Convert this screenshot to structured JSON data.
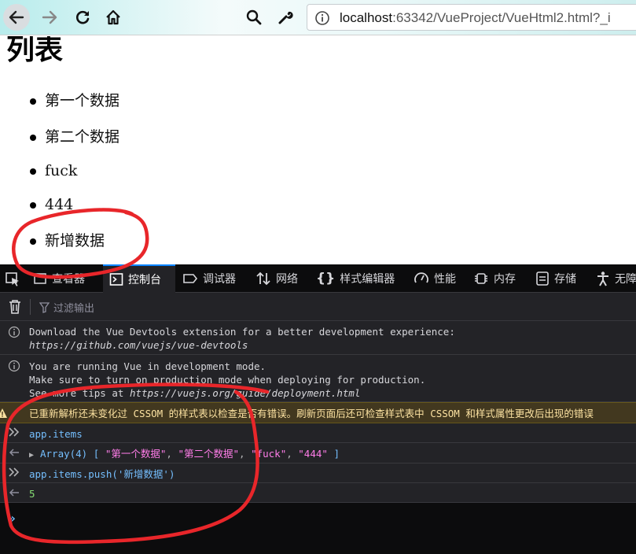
{
  "browser": {
    "url_host": "localhost",
    "url_rest": ":63342/VueProject/VueHtml2.html?_i"
  },
  "page": {
    "title": "列表",
    "items": [
      "第一个数据",
      "第二个数据",
      "fuck",
      "444",
      "新增数据"
    ]
  },
  "devtools": {
    "tabs": [
      {
        "label": "查看器"
      },
      {
        "label": "控制台"
      },
      {
        "label": "调试器"
      },
      {
        "label": "网络"
      },
      {
        "label": "样式编辑器"
      },
      {
        "label": "性能"
      },
      {
        "label": "内存"
      },
      {
        "label": "存储"
      },
      {
        "label": "无障"
      }
    ],
    "filter_placeholder": "过滤输出",
    "messages": {
      "devtools_line1": "Download the Vue Devtools extension for a better development experience:",
      "devtools_line2": "https://github.com/vuejs/vue-devtools",
      "dev_mode_line1": "You are running Vue in development mode.",
      "dev_mode_line2": "Make sure to turn on production mode when deploying for production.",
      "dev_mode_line3_prefix": "See more tips at ",
      "dev_mode_line3_url": "https://vuejs.org/guide/deployment.html",
      "warning": "已重新解析还未变化过 CSSOM 的样式表以检查是否有错误。刷新页面后还可检查样式表中 CSSOM 和样式属性更改后出现的错误",
      "cmd1": "app.items",
      "result1_type": "Array(4)",
      "result1_open": "[",
      "result1_items": [
        "\"第一个数据\"",
        "\"第二个数据\"",
        "\"fuck\"",
        "\"444\""
      ],
      "result1_close": "]",
      "cmd2_prefix": "app.items.push(",
      "cmd2_arg": "'新增数据'",
      "cmd2_suffix": ")",
      "result2": "5"
    }
  },
  "colors": {
    "annotation": "#e8262a",
    "devtools_bg": "#232327",
    "accent": "#0a84ff"
  }
}
